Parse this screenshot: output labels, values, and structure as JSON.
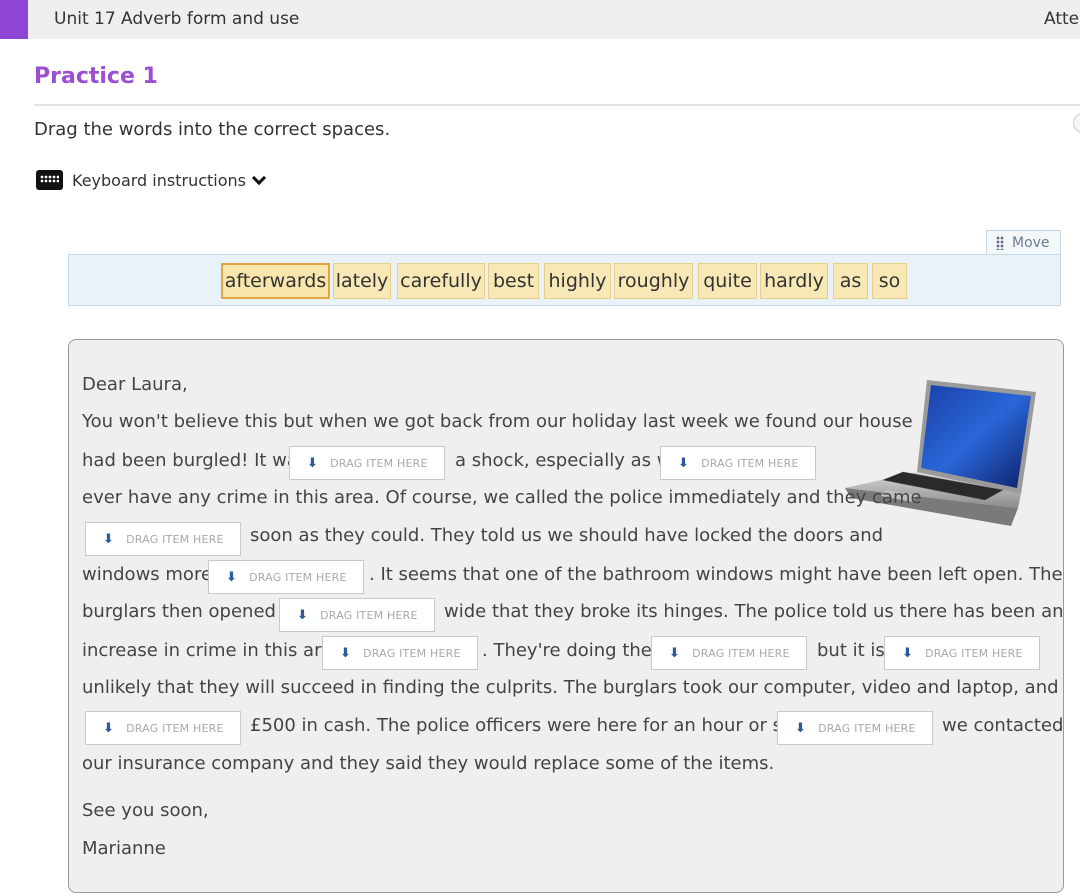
{
  "header": {
    "unit_title": "Unit 17 Adverb form and use",
    "right_text": "Atte",
    "accent_color": "#8e44d4"
  },
  "practice_title": "Practice 1",
  "instruction": "Drag the words into the correct spaces.",
  "keyboard": {
    "label": "Keyboard instructions",
    "icon": "keyboard-icon"
  },
  "move_label": "Move",
  "word_bank": [
    "afterwards",
    "lately",
    "carefully",
    "best",
    "highly",
    "roughly",
    "quite",
    "hardly",
    "as",
    "so"
  ],
  "selected_word": "afterwards",
  "drop_placeholder": "DRAG ITEM HERE",
  "passage": {
    "greeting": "Dear Laura,",
    "t1": "You won't believe this but when we got back from our holiday last week we found our house",
    "t2": "had been burgled! It was",
    "t3": "a shock, especially as we",
    "t4": "ever have any crime in this area. Of course, we called the police immediately and they came",
    "t5": "soon as they could. They told us we should have locked the doors and",
    "t6": "windows more",
    "t7": ". It seems that one of the bathroom windows might have been left open. The",
    "t8": "burglars then opened it",
    "t9": "wide that they broke its hinges. The police told us there has been an",
    "t10": "increase in crime in this area",
    "t11": ". They're doing their",
    "t12": "but it is",
    "t13": "unlikely that they will succeed in finding the culprits. The burglars took our computer, video and laptop, and",
    "t14": "£500 in cash. The police officers were here for an hour or so and",
    "t15": "we contacted",
    "t16": "our insurance company and they said they would replace some of the items.",
    "closing": "See you soon,",
    "signature": "Marianne"
  },
  "colors": {
    "title": "#9b4fd1",
    "chip_bg": "#f7e8b5",
    "word_bank_bg": "#e9f2f8",
    "passage_bg": "#efefef"
  }
}
